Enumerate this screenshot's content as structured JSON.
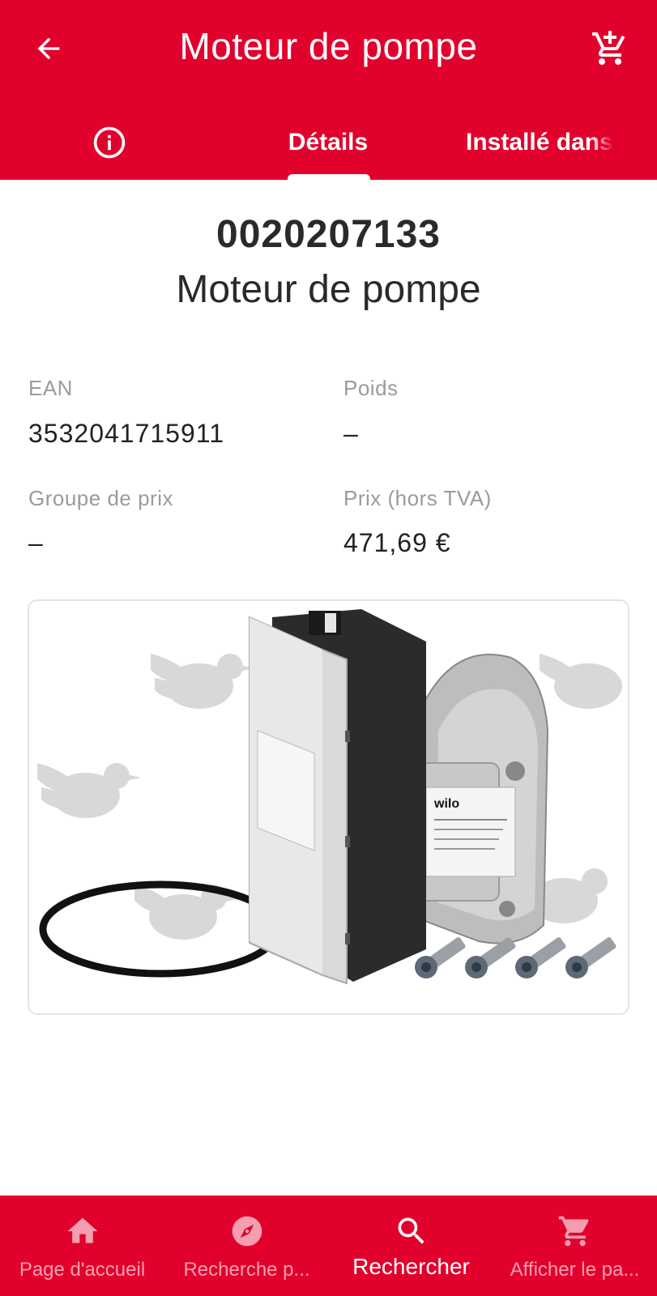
{
  "header": {
    "title": "Moteur de pompe",
    "back_icon": "arrow-left-icon",
    "cart_icon": "cart-add-icon"
  },
  "tabs": [
    {
      "icon": "info-icon",
      "label": ""
    },
    {
      "label": "Détails",
      "active": true
    },
    {
      "label": "Installé dans"
    }
  ],
  "product": {
    "code": "0020207133",
    "name": "Moteur de pompe"
  },
  "fields": {
    "ean_label": "EAN",
    "ean_value": "3532041715911",
    "weight_label": "Poids",
    "weight_value": "–",
    "price_group_label": "Groupe de prix",
    "price_group_value": "–",
    "price_label": "Prix (hors TVA)",
    "price_value": "471,69 €"
  },
  "image": {
    "brand_text": "wilo",
    "watermark_icon": "bird-watermark-icon"
  },
  "bottom_nav": [
    {
      "icon": "home-icon",
      "label": "Page d'accueil"
    },
    {
      "icon": "compass-icon",
      "label": "Recherche p..."
    },
    {
      "icon": "search-icon",
      "label": "Rechercher",
      "active": true
    },
    {
      "icon": "cart-icon",
      "label": "Afficher le pa..."
    }
  ],
  "colors": {
    "brand_red": "#e2002d",
    "label_gray": "#9b9b9b"
  }
}
